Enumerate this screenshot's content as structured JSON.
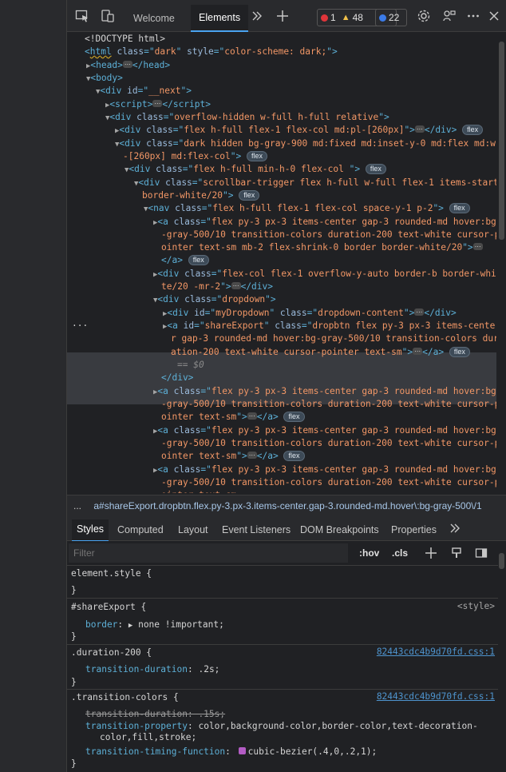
{
  "toolbar": {
    "tabs": [
      "Welcome",
      "Elements"
    ],
    "errors": "1",
    "warnings": "48",
    "issues": "22"
  },
  "dom": {
    "l1": "<!DOCTYPE html>",
    "l2_tag": "html",
    "l2_class": "dark",
    "l2_style": "color-scheme: dark;",
    "l3": "head",
    "l4": "body",
    "l5_id": "__next",
    "l6": "script",
    "l7_class": "overflow-hidden w-full h-full relative",
    "l8_class": "flex h-full flex-1 flex-col md:pl-[260px]",
    "l9_class_a": "dark hidden bg-gray-900 md:fixed md:inset-y-0 md:flex md:w",
    "l9_class_b": "-[260px] md:flex-col",
    "l10_class": "flex h-full min-h-0 flex-col ",
    "l11_class_a": "scrollbar-trigger flex h-full w-full flex-1 items-start",
    "l11_class_b": "border-white/20",
    "l12_class": "flex h-full flex-1 flex-col space-y-1 p-2",
    "l13_a": "flex py-3 px-3 items-center gap-3 rounded-md hover:bg",
    "l13_b": "-gray-500/10 transition-colors duration-200 text-white cursor-p",
    "l13_c": "ointer text-sm mb-2 flex-shrink-0 border border-white/20",
    "l14_a": "flex-col flex-1 overflow-y-auto border-b border-whi",
    "l14_b": "te/20 -mr-2",
    "l15_class": "dropdown",
    "l16_id": "myDropdown",
    "l16_class": "dropdown-content",
    "l17_id": "shareExport",
    "l17_a": "dropbtn flex py-3 px-3 items-cente",
    "l17_b": "r gap-3 rounded-md hover:bg-gray-500/10 transition-colors dur",
    "l17_c": "ation-200 text-white cursor-pointer text-sm",
    "l17_d": "== $0",
    "l18_a": "flex py-3 px-3 items-center gap-3 rounded-md hover:bg",
    "l18_b": "-gray-500/10 transition-colors duration-200 text-white cursor-p",
    "l18_c": "ointer text-sm",
    "flex_badge": "flex"
  },
  "breadcrumb": {
    "dots": "...",
    "path": "a#shareExport.dropbtn.flex.py-3.px-3.items-center.gap-3.rounded-md.hover\\:bg-gray-500\\/1"
  },
  "styles_tabs": [
    "Styles",
    "Computed",
    "Layout",
    "Event Listeners",
    "DOM Breakpoints",
    "Properties"
  ],
  "filter": {
    "placeholder": "Filter",
    "hov": ":hov",
    "cls": ".cls"
  },
  "rules": {
    "element_style": "element.style {",
    "close": "}",
    "r1_sel": "#shareExport {",
    "r1_src": "<style>",
    "r1_prop": "border",
    "r1_val": "none !important;",
    "r2_sel": ".duration-200 {",
    "r2_src": "82443cdc4b9d70fd.css:1",
    "r2_prop": "transition-duration",
    "r2_val": ".2s;",
    "r3_sel": ".transition-colors {",
    "r3_src": "82443cdc4b9d70fd.css:1",
    "r3_p1": "transition-duration: .15s;",
    "r3_p2": "transition-property",
    "r3_v2a": "color,background-color,border-color,text-decoration-",
    "r3_v2b": "color,fill,stroke;",
    "r3_p3": "transition-timing-function",
    "r3_v3": "cubic-bezier(.4,0,.2,1);"
  }
}
